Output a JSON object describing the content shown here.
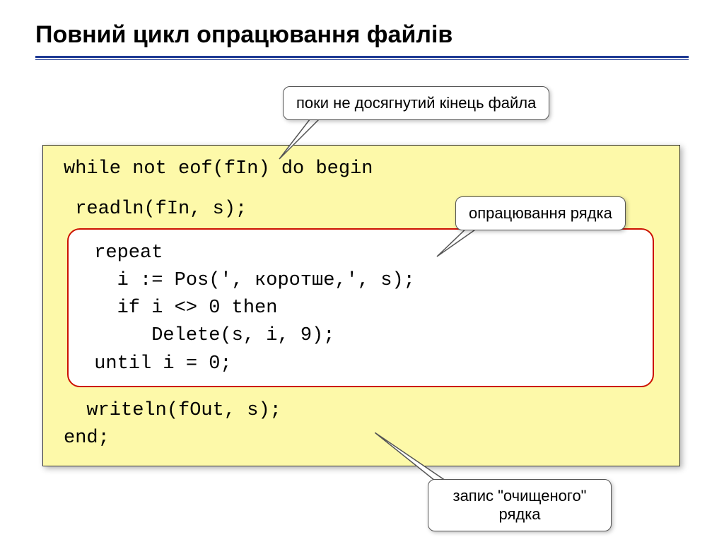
{
  "title": "Повний цикл опрацювання файлів",
  "callouts": {
    "top": "поки не досягнутий кінець файла",
    "right": "опрацювання рядка",
    "bottom": "запис \"очищеного\" рядка"
  },
  "code": {
    "line1": "while not eof(fIn) do begin",
    "line2": " readln(fIn, s);",
    "inner1": " repeat",
    "inner2": "   i := Pos(', коротше,', s);",
    "inner3": "   if i <> 0 then",
    "inner4": "      Delete(s, i, 9);",
    "inner5": " until i = 0;",
    "line3": "  writeln(fOut, s);",
    "line4": "end;"
  }
}
